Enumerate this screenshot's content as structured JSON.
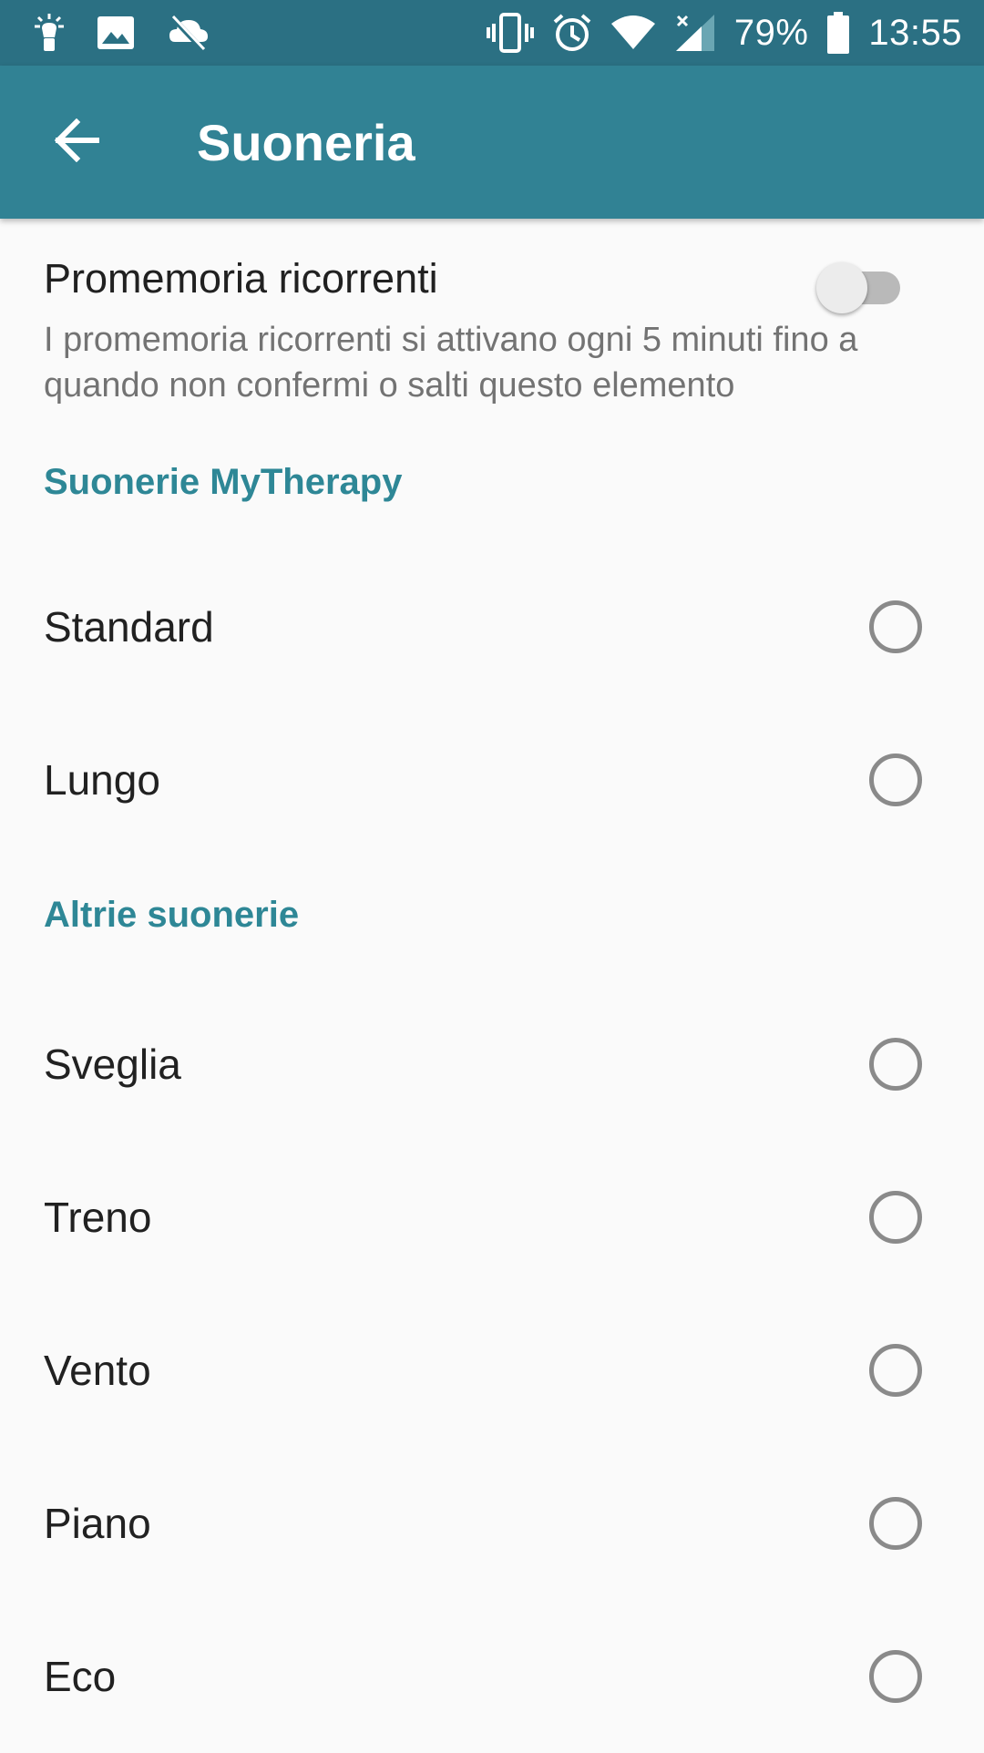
{
  "status_bar": {
    "battery_text": "79%",
    "time": "13:55",
    "icons": [
      "flashlight-icon",
      "image-icon",
      "no-sync-icon",
      "vibrate-icon",
      "alarm-icon",
      "wifi-icon",
      "signal-icon",
      "battery-icon"
    ]
  },
  "app_bar": {
    "title": "Suoneria",
    "back_icon": "arrow-back-icon"
  },
  "recurring": {
    "title": "Promemoria ricorrenti",
    "summary": "I promemoria ricorrenti si attivano ogni 5 minuti fino a quando non confermi o salti questo elemento",
    "enabled": false
  },
  "sections": {
    "mytherapy": {
      "header": "Suonerie MyTherapy",
      "items": [
        {
          "label": "Standard",
          "selected": false
        },
        {
          "label": "Lungo",
          "selected": false
        }
      ]
    },
    "other": {
      "header": "Altrie suonerie",
      "items": [
        {
          "label": "Sveglia",
          "selected": false
        },
        {
          "label": "Treno",
          "selected": false
        },
        {
          "label": "Vento",
          "selected": false
        },
        {
          "label": "Piano",
          "selected": false
        },
        {
          "label": "Eco",
          "selected": false
        }
      ]
    }
  },
  "colors": {
    "status_bar": "#2b7083",
    "app_bar": "#318294",
    "accent": "#2e8796",
    "background": "#fafafa"
  }
}
